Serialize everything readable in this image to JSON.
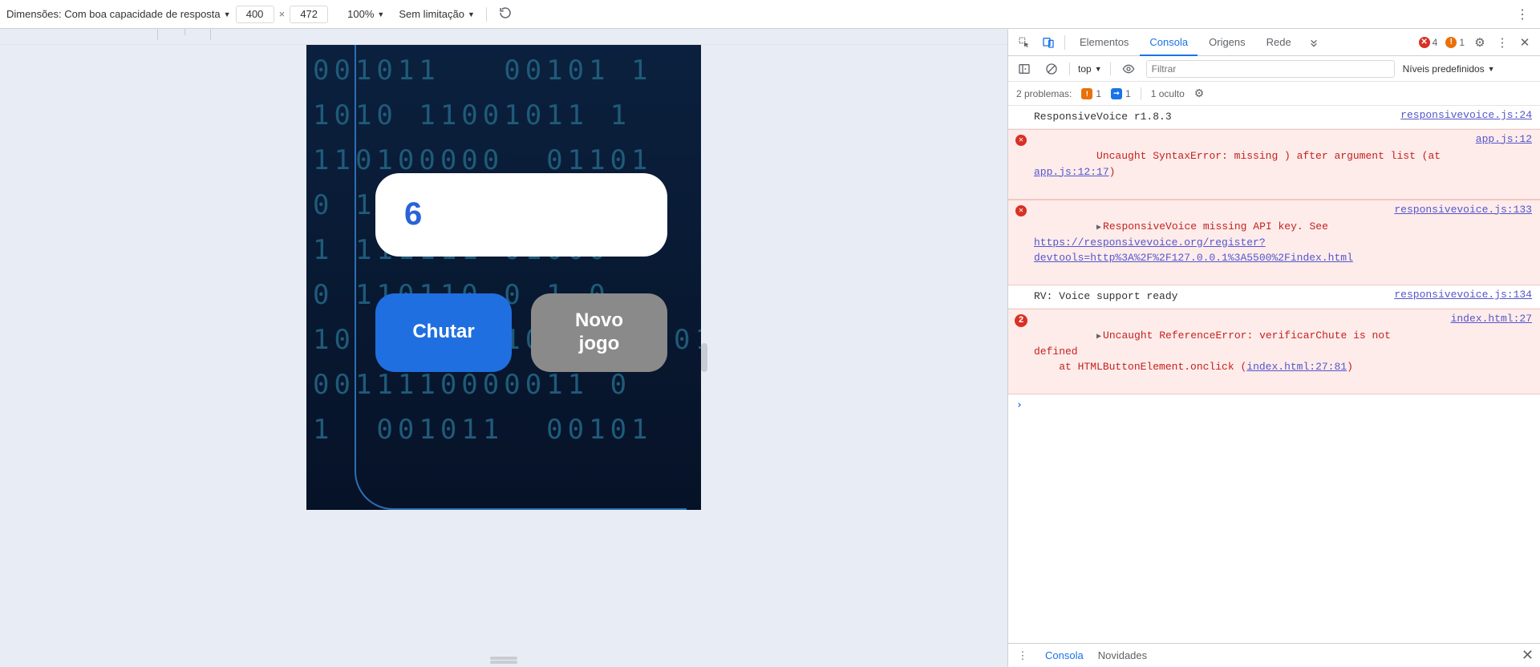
{
  "device_toolbar": {
    "dimensions_label": "Dimensões: Com boa capacidade de resposta",
    "width": "400",
    "height": "472",
    "zoom": "100%",
    "throttle": "Sem limitação"
  },
  "app": {
    "guess_value": "6",
    "chutar_label": "Chutar",
    "novojogo_label": "Novo\njogo",
    "matrix_text": "001011   00101 1\n1010 11001011 1\n110100000  01101\n0 1 0 1 0 1 1 0\n1 111111 01000\n0 110110 0 1 0\n10  0000 101 1  0011\n0011110000011 0\n1  001011  00101"
  },
  "devtools": {
    "tabs": {
      "elements": "Elementos",
      "console": "Consola",
      "sources": "Origens",
      "network": "Rede"
    },
    "error_count": "4",
    "warn_count": "1",
    "subbar": {
      "context": "top",
      "filter_placeholder": "Filtrar",
      "levels": "Níveis predefinidos"
    },
    "issuesbar": {
      "label": "2 problemas:",
      "warn_n": "1",
      "info_n": "1",
      "hidden": "1 oculto"
    },
    "logs": [
      {
        "type": "log",
        "msg": "ResponsiveVoice r1.8.3",
        "src": "responsivevoice.js:24"
      },
      {
        "type": "error",
        "msg_pre": "Uncaught SyntaxError: missing ) after argument list (at ",
        "link1": "app.js:12:17",
        "msg_post": ")",
        "src": "app.js:12"
      },
      {
        "type": "error",
        "expandable": true,
        "msg_pre": "ResponsiveVoice missing API key. See ",
        "link1": "https://responsivevoice.org/register?devtools=http%3A%2F%2F127.0.0.1%3A5500%2Findex.html",
        "src": "responsivevoice.js:133"
      },
      {
        "type": "log",
        "msg": "RV: Voice support ready",
        "src": "responsivevoice.js:134"
      },
      {
        "type": "error",
        "count": "2",
        "expandable": true,
        "msg_pre": "Uncaught ReferenceError: verificarChute is not defined\n    at HTMLButtonElement.onclick (",
        "link1": "index.html:27:81",
        "msg_post": ")",
        "src": "index.html:27"
      }
    ],
    "drawer": {
      "console": "Consola",
      "news": "Novidades"
    }
  }
}
